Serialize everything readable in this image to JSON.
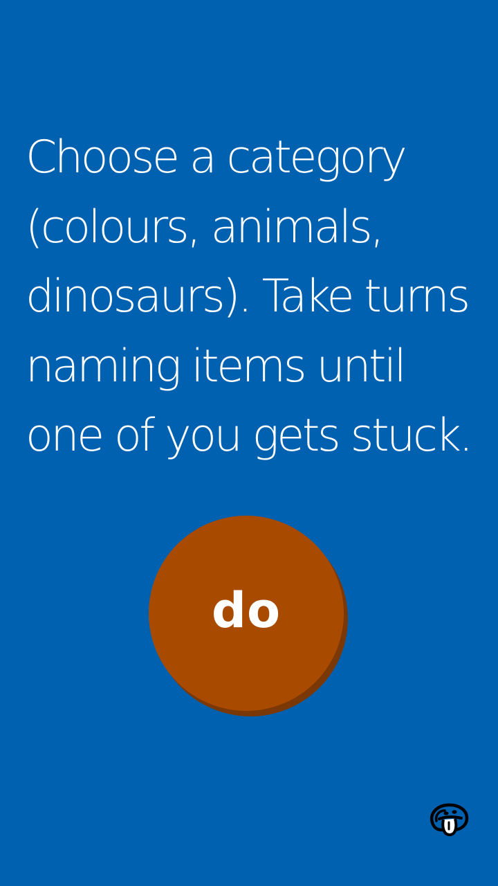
{
  "colors": {
    "background": "#0061b0",
    "instruction_text": "#ffffff",
    "button_face": "#a84a00",
    "button_shadow": "#7a3806",
    "button_label": "#ffffff",
    "logo": "#000000"
  },
  "instruction": {
    "text": "Choose a category (colours, animals, dinosaurs). Take turns naming items until one of you gets stuck."
  },
  "action_button": {
    "label": "do"
  },
  "logo": {
    "icon": "tongue-face-icon"
  }
}
